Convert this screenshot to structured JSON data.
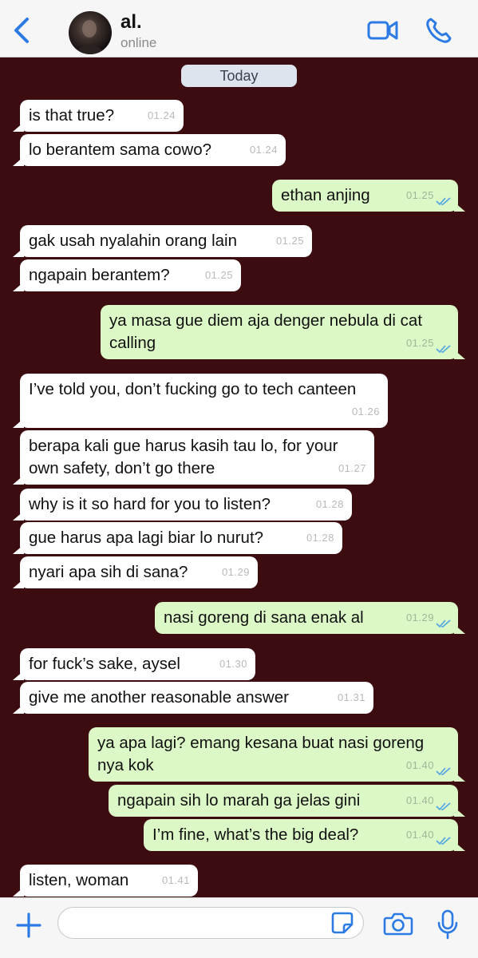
{
  "header": {
    "contact_name": "al.",
    "status": "online"
  },
  "date_separator": "Today",
  "accent_color": "#2c7be5",
  "messages": [
    {
      "dir": "in",
      "text": "is that true?",
      "time": "01.24"
    },
    {
      "dir": "in",
      "text": "lo berantem sama cowo?",
      "time": "01.24"
    },
    {
      "dir": "out",
      "text": "ethan anjing",
      "time": "01.25",
      "read": true
    },
    {
      "dir": "in",
      "text": "gak usah nyalahin orang lain",
      "time": "01.25"
    },
    {
      "dir": "in",
      "text": "ngapain berantem?",
      "time": "01.25"
    },
    {
      "dir": "out",
      "text": "ya masa gue diem aja denger nebula di cat calling",
      "time": "01.25",
      "read": true
    },
    {
      "dir": "in",
      "text": "I’ve told you, don’t fucking go to tech canteen",
      "time": "01.26"
    },
    {
      "dir": "in",
      "text": "berapa kali gue harus kasih tau lo, for your own safety, don’t go there",
      "time": "01.27"
    },
    {
      "dir": "in",
      "text": "why is it so hard for you to listen?",
      "time": "01.28"
    },
    {
      "dir": "in",
      "text": "gue harus apa lagi biar lo nurut?",
      "time": "01.28"
    },
    {
      "dir": "in",
      "text": "nyari apa sih di sana?",
      "time": "01.29"
    },
    {
      "dir": "out",
      "text": "nasi goreng di sana enak al",
      "time": "01.29",
      "read": true
    },
    {
      "dir": "in",
      "text": "for fuck’s sake, aysel",
      "time": "01.30"
    },
    {
      "dir": "in",
      "text": "give me another reasonable answer",
      "time": "01.31"
    },
    {
      "dir": "out",
      "text": "ya apa lagi? emang kesana buat nasi goreng nya kok",
      "time": "01.40",
      "read": true
    },
    {
      "dir": "out",
      "text": "ngapain sih lo marah ga jelas gini",
      "time": "01.40",
      "read": true
    },
    {
      "dir": "out",
      "text": "I’m fine, what’s the big deal?",
      "time": "01.40",
      "read": true
    },
    {
      "dir": "in",
      "text": "listen, woman",
      "time": "01.41"
    }
  ]
}
